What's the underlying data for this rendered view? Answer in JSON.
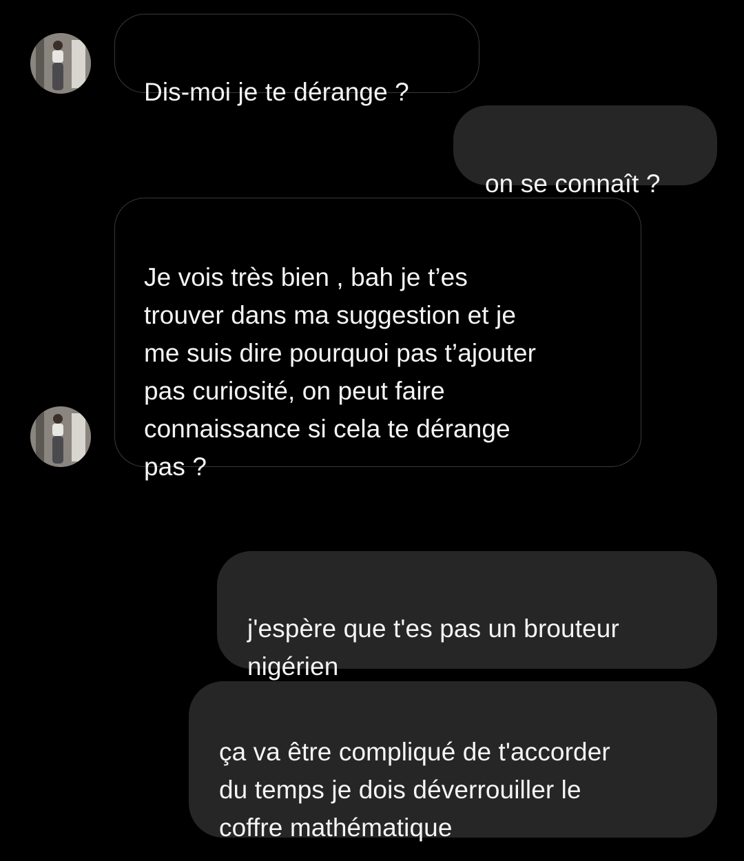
{
  "conversation": {
    "messages": [
      {
        "direction": "incoming",
        "text": "Dis-moi je te dérange ?"
      },
      {
        "direction": "outgoing",
        "text": "on se connaît ?"
      },
      {
        "direction": "incoming",
        "text": "Je vois très bien , bah je t’es\ntrouver dans ma suggestion et je\nme suis dire pourquoi pas t’ajouter\npas curiosité, on peut faire\nconnaissance si cela te dérange\npas ?"
      },
      {
        "direction": "outgoing",
        "text": "j'espère que t'es pas un brouteur\nnigérien"
      },
      {
        "direction": "outgoing",
        "text": "ça va être compliqué de t'accorder\ndu temps je dois déverrouiller le\ncoffre mathématique"
      }
    ]
  },
  "colors": {
    "background": "#000000",
    "incoming_border": "#3a3a3a",
    "outgoing_bubble": "#262626",
    "text": "#f5f5f5"
  },
  "icons": {
    "sender_avatar": "sender-avatar-photo"
  }
}
